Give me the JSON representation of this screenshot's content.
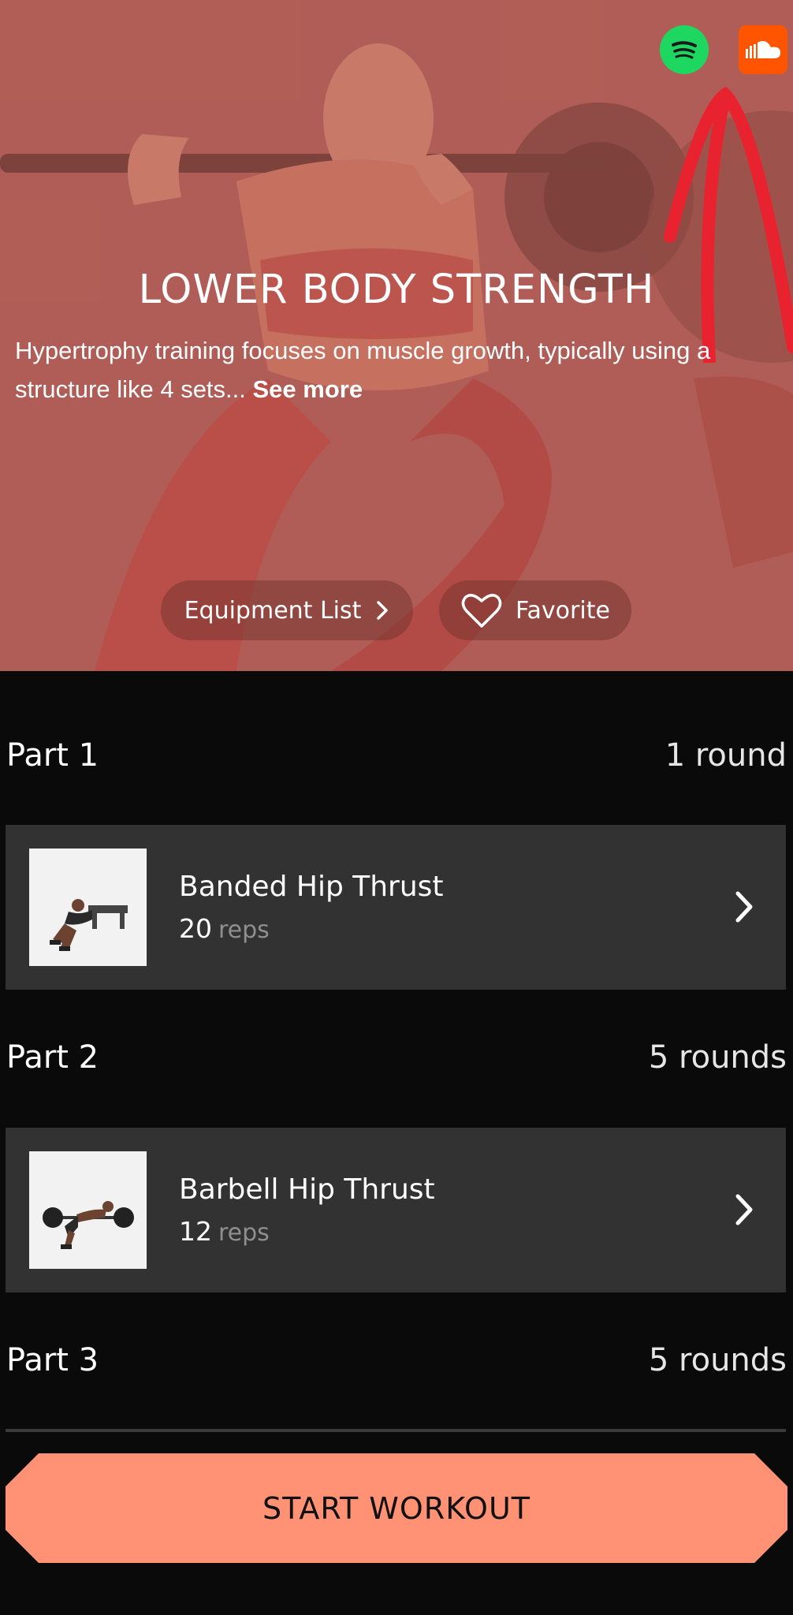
{
  "hero": {
    "title": "LOWER BODY STRENGTH",
    "description": "Hypertrophy training focuses on muscle growth, typically using a structure like 4 sets... ",
    "see_more": "See more",
    "equipment_label": "Equipment List",
    "favorite_label": "Favorite",
    "icons": [
      "spotify-icon",
      "soundcloud-icon",
      "heart-icon",
      "chevron-right-icon"
    ]
  },
  "parts": [
    {
      "label": "Part 1",
      "rounds": "1 round"
    },
    {
      "label": "Part 2",
      "rounds": "5 rounds"
    },
    {
      "label": "Part 3",
      "rounds": "5 rounds"
    }
  ],
  "exercises": [
    {
      "name": "Banded Hip Thrust",
      "count": "20",
      "unit": "reps"
    },
    {
      "name": "Barbell Hip Thrust",
      "count": "12",
      "unit": "reps"
    }
  ],
  "start_button": "START WORKOUT",
  "colors": {
    "accent": "#ff9175",
    "card": "#323232",
    "background": "#0a0a0a",
    "spotify": "#1ed760",
    "soundcloud": "#ff5500",
    "annotation_arrow": "#e8222e"
  }
}
